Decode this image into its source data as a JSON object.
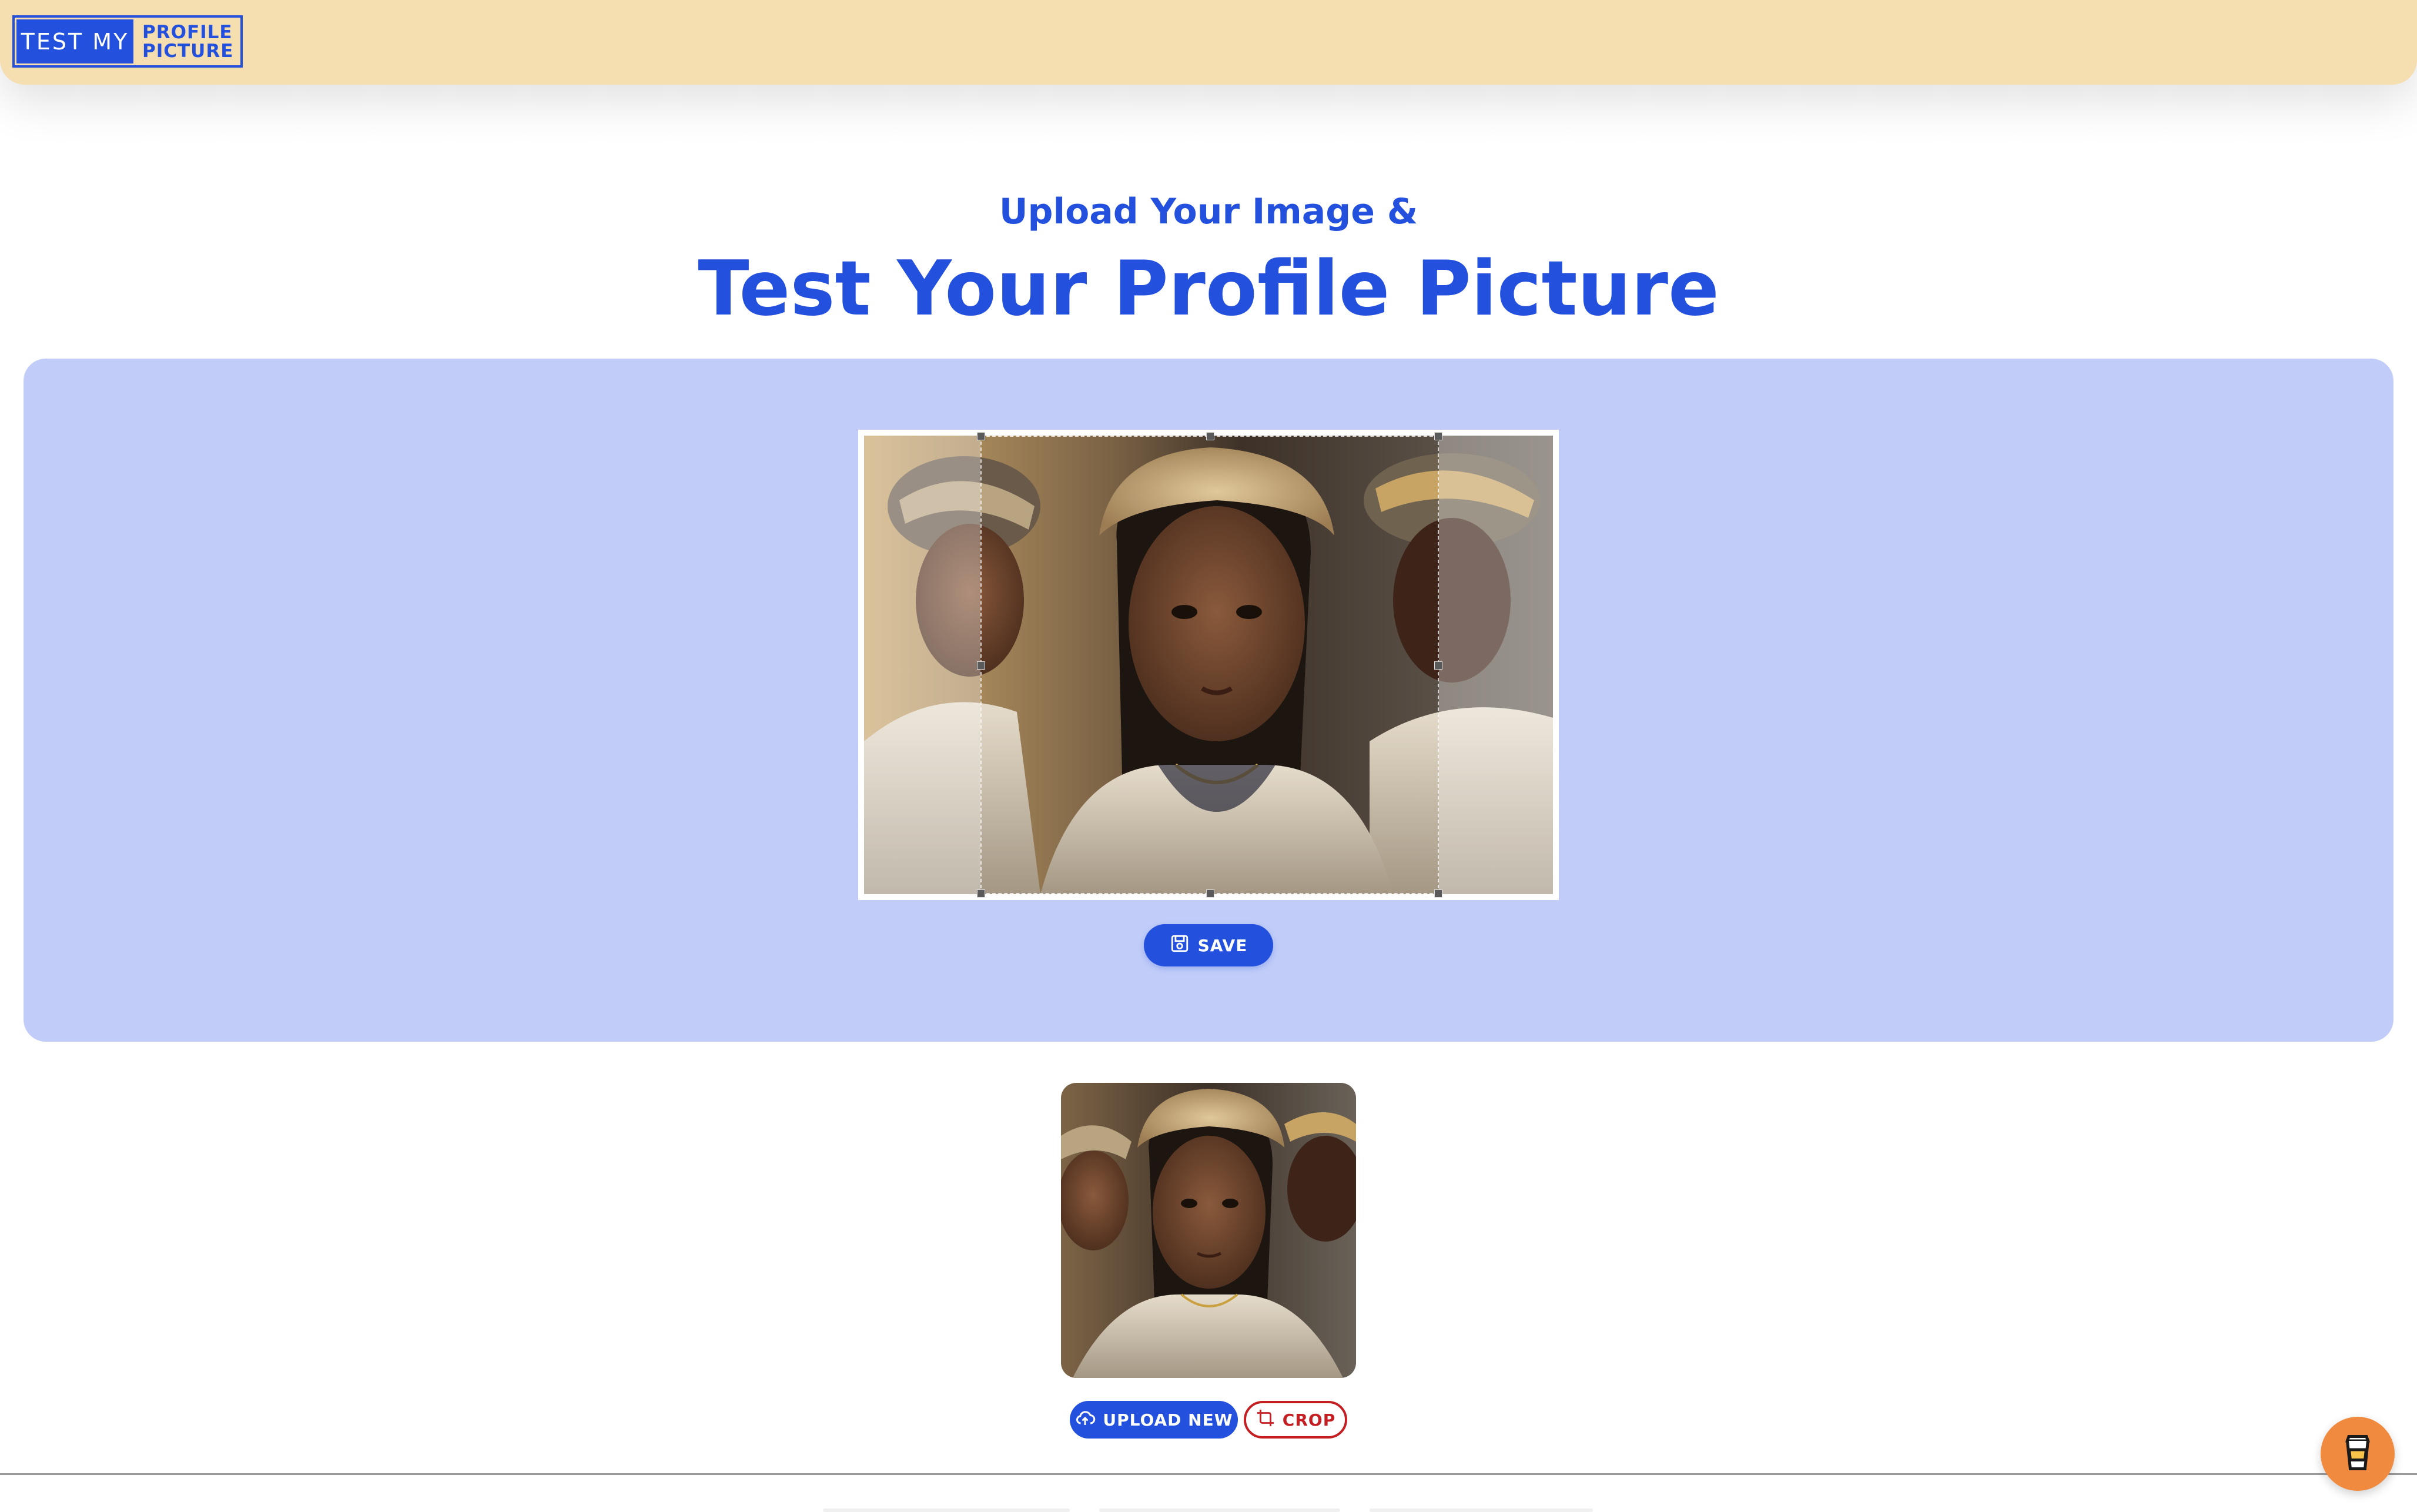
{
  "header": {
    "logo": {
      "left_text": "TEST MY",
      "right_line1": "PROFILE",
      "right_line2": "PICTURE"
    }
  },
  "hero": {
    "subtitle": "Upload Your Image &",
    "title": "Test Your Profile Picture"
  },
  "editor": {
    "save_label": "SAVE"
  },
  "actions": {
    "upload_label": "UPLOAD NEW",
    "crop_label": "CROP"
  },
  "colors": {
    "brand_blue": "#2450de",
    "header_bg": "#f5dfb0",
    "panel_bg": "#c1cdf8",
    "crop_red": "#c41e22",
    "coffee_orange": "#f08a3e"
  },
  "icons": {
    "save": "floppy-disk-icon",
    "upload": "cloud-upload-icon",
    "crop": "crop-icon",
    "coffee": "coffee-cup-icon"
  }
}
